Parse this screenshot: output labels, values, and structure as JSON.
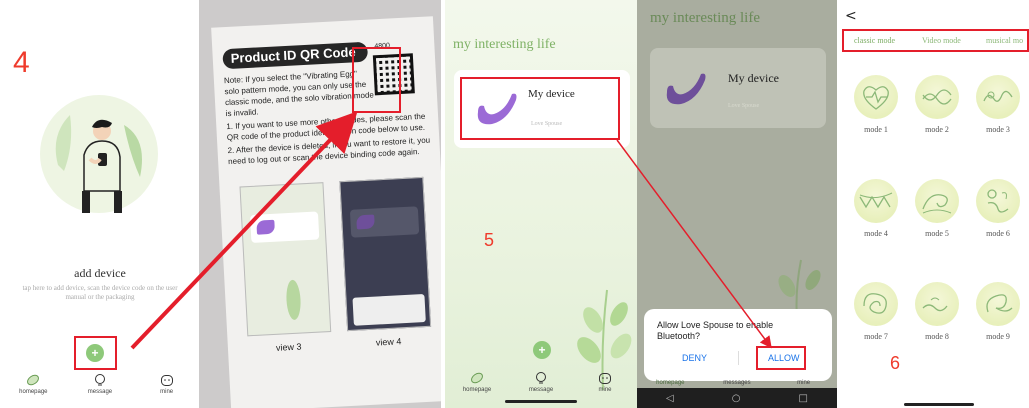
{
  "steps": {
    "s4": "4",
    "s5": "5",
    "s6": "6"
  },
  "colors": {
    "accent_green": "#8ec97a",
    "annotation_red": "#e41e2b",
    "title_green": "#7fb266"
  },
  "panel1": {
    "add_title": "add device",
    "add_subtitle": "tap here to add device, scan the device code on the user manual or the packaging",
    "plus_label": "+",
    "tabs": [
      {
        "label": "homepage",
        "icon": "leaf-icon"
      },
      {
        "label": "message",
        "icon": "bulb-icon"
      },
      {
        "label": "mine",
        "icon": "face-icon"
      }
    ]
  },
  "panel2": {
    "title": "Product ID QR Code",
    "paragraph1": "Note: If you select the \"Vibrating Egg\" solo pattern mode, you can only use the classic mode, and the solo vibration mode is invalid.",
    "paragraph2": "1. If you want to use more other modes, please scan the QR code of the product identification code below to use.",
    "paragraph3": "2. After the device is deleted, if you want to restore it, you need to log out or scan the device binding code again.",
    "qr_number": "4800",
    "view3": "view 3",
    "view4": "view 4"
  },
  "panel3": {
    "app_title": "my interesting life",
    "device_name": "My device",
    "device_sub": "Love Spouse",
    "plus_label": "+",
    "tabs": [
      {
        "label": "homepage",
        "icon": "leaf-icon"
      },
      {
        "label": "message",
        "icon": "bulb-icon"
      },
      {
        "label": "mine",
        "icon": "face-icon"
      }
    ]
  },
  "panel4": {
    "app_title": "my interesting life",
    "device_name": "My device",
    "device_sub": "Love Spouse",
    "dialog_text": "Allow Love Spouse to enable Bluetooth?",
    "deny": "DENY",
    "allow": "ALLOW",
    "tabs": [
      "homepage",
      "messages",
      "mine"
    ],
    "nav": {
      "back": "◁",
      "home": "○",
      "recent": "□"
    }
  },
  "panel5": {
    "back": "<",
    "mode_tabs": [
      "classic mode",
      "Video mode",
      "musical mo"
    ],
    "modes": [
      {
        "label": "mode 1",
        "icon": "heart-pulse-icon"
      },
      {
        "label": "mode 2",
        "icon": "wave-icon"
      },
      {
        "label": "mode 3",
        "icon": "swirl-icon"
      },
      {
        "label": "mode 4",
        "icon": "zigzag-icon"
      },
      {
        "label": "mode 5",
        "icon": "big-wave-icon"
      },
      {
        "label": "mode 6",
        "icon": "spiral-icon"
      },
      {
        "label": "mode 7",
        "icon": "loop-icon"
      },
      {
        "label": "mode 8",
        "icon": "ripple-icon"
      },
      {
        "label": "mode 9",
        "icon": "curl-icon"
      }
    ]
  }
}
